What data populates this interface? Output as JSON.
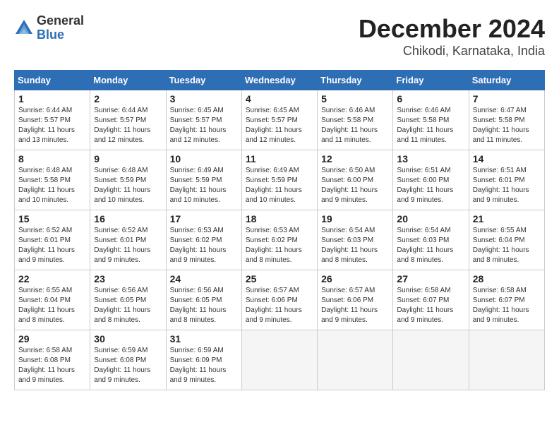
{
  "header": {
    "logo_general": "General",
    "logo_blue": "Blue",
    "month": "December 2024",
    "location": "Chikodi, Karnataka, India"
  },
  "days_of_week": [
    "Sunday",
    "Monday",
    "Tuesday",
    "Wednesday",
    "Thursday",
    "Friday",
    "Saturday"
  ],
  "weeks": [
    [
      {
        "day": 1,
        "sunrise": "6:44 AM",
        "sunset": "5:57 PM",
        "daylight": "11 hours and 13 minutes."
      },
      {
        "day": 2,
        "sunrise": "6:44 AM",
        "sunset": "5:57 PM",
        "daylight": "11 hours and 12 minutes."
      },
      {
        "day": 3,
        "sunrise": "6:45 AM",
        "sunset": "5:57 PM",
        "daylight": "11 hours and 12 minutes."
      },
      {
        "day": 4,
        "sunrise": "6:45 AM",
        "sunset": "5:57 PM",
        "daylight": "11 hours and 12 minutes."
      },
      {
        "day": 5,
        "sunrise": "6:46 AM",
        "sunset": "5:58 PM",
        "daylight": "11 hours and 11 minutes."
      },
      {
        "day": 6,
        "sunrise": "6:46 AM",
        "sunset": "5:58 PM",
        "daylight": "11 hours and 11 minutes."
      },
      {
        "day": 7,
        "sunrise": "6:47 AM",
        "sunset": "5:58 PM",
        "daylight": "11 hours and 11 minutes."
      }
    ],
    [
      {
        "day": 8,
        "sunrise": "6:48 AM",
        "sunset": "5:58 PM",
        "daylight": "11 hours and 10 minutes."
      },
      {
        "day": 9,
        "sunrise": "6:48 AM",
        "sunset": "5:59 PM",
        "daylight": "11 hours and 10 minutes."
      },
      {
        "day": 10,
        "sunrise": "6:49 AM",
        "sunset": "5:59 PM",
        "daylight": "11 hours and 10 minutes."
      },
      {
        "day": 11,
        "sunrise": "6:49 AM",
        "sunset": "5:59 PM",
        "daylight": "11 hours and 10 minutes."
      },
      {
        "day": 12,
        "sunrise": "6:50 AM",
        "sunset": "6:00 PM",
        "daylight": "11 hours and 9 minutes."
      },
      {
        "day": 13,
        "sunrise": "6:51 AM",
        "sunset": "6:00 PM",
        "daylight": "11 hours and 9 minutes."
      },
      {
        "day": 14,
        "sunrise": "6:51 AM",
        "sunset": "6:01 PM",
        "daylight": "11 hours and 9 minutes."
      }
    ],
    [
      {
        "day": 15,
        "sunrise": "6:52 AM",
        "sunset": "6:01 PM",
        "daylight": "11 hours and 9 minutes."
      },
      {
        "day": 16,
        "sunrise": "6:52 AM",
        "sunset": "6:01 PM",
        "daylight": "11 hours and 9 minutes."
      },
      {
        "day": 17,
        "sunrise": "6:53 AM",
        "sunset": "6:02 PM",
        "daylight": "11 hours and 9 minutes."
      },
      {
        "day": 18,
        "sunrise": "6:53 AM",
        "sunset": "6:02 PM",
        "daylight": "11 hours and 8 minutes."
      },
      {
        "day": 19,
        "sunrise": "6:54 AM",
        "sunset": "6:03 PM",
        "daylight": "11 hours and 8 minutes."
      },
      {
        "day": 20,
        "sunrise": "6:54 AM",
        "sunset": "6:03 PM",
        "daylight": "11 hours and 8 minutes."
      },
      {
        "day": 21,
        "sunrise": "6:55 AM",
        "sunset": "6:04 PM",
        "daylight": "11 hours and 8 minutes."
      }
    ],
    [
      {
        "day": 22,
        "sunrise": "6:55 AM",
        "sunset": "6:04 PM",
        "daylight": "11 hours and 8 minutes."
      },
      {
        "day": 23,
        "sunrise": "6:56 AM",
        "sunset": "6:05 PM",
        "daylight": "11 hours and 8 minutes."
      },
      {
        "day": 24,
        "sunrise": "6:56 AM",
        "sunset": "6:05 PM",
        "daylight": "11 hours and 8 minutes."
      },
      {
        "day": 25,
        "sunrise": "6:57 AM",
        "sunset": "6:06 PM",
        "daylight": "11 hours and 9 minutes."
      },
      {
        "day": 26,
        "sunrise": "6:57 AM",
        "sunset": "6:06 PM",
        "daylight": "11 hours and 9 minutes."
      },
      {
        "day": 27,
        "sunrise": "6:58 AM",
        "sunset": "6:07 PM",
        "daylight": "11 hours and 9 minutes."
      },
      {
        "day": 28,
        "sunrise": "6:58 AM",
        "sunset": "6:07 PM",
        "daylight": "11 hours and 9 minutes."
      }
    ],
    [
      {
        "day": 29,
        "sunrise": "6:58 AM",
        "sunset": "6:08 PM",
        "daylight": "11 hours and 9 minutes."
      },
      {
        "day": 30,
        "sunrise": "6:59 AM",
        "sunset": "6:08 PM",
        "daylight": "11 hours and 9 minutes."
      },
      {
        "day": 31,
        "sunrise": "6:59 AM",
        "sunset": "6:09 PM",
        "daylight": "11 hours and 9 minutes."
      },
      null,
      null,
      null,
      null
    ]
  ]
}
